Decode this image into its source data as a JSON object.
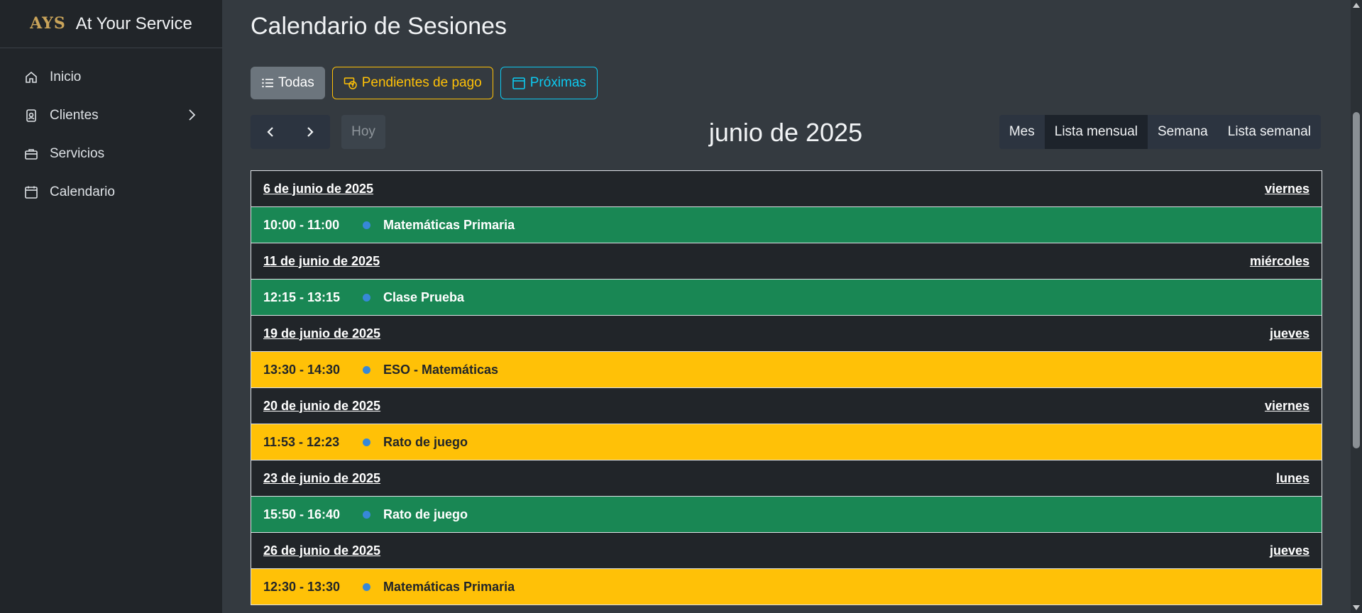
{
  "app": {
    "logo_text": "AYS",
    "name": "At Your Service"
  },
  "sidebar": {
    "items": [
      {
        "label": "Inicio",
        "icon": "home-icon"
      },
      {
        "label": "Clientes",
        "icon": "user-badge-icon",
        "has_submenu": true
      },
      {
        "label": "Servicios",
        "icon": "briefcase-icon"
      },
      {
        "label": "Calendario",
        "icon": "calendar-icon"
      }
    ]
  },
  "page": {
    "title": "Calendario de Sesiones"
  },
  "filters": {
    "todas": "Todas",
    "pendientes": "Pendientes de pago",
    "proximas": "Próximas"
  },
  "toolbar": {
    "today": "Hoy",
    "month_title": "junio de 2025",
    "views": [
      "Mes",
      "Lista mensual",
      "Semana",
      "Lista semanal"
    ],
    "active_view": "Lista mensual"
  },
  "colors": {
    "paid": "#198754",
    "pending": "#ffc107",
    "event_dot": "#3788d8"
  },
  "days": [
    {
      "date": "6 de junio de 2025",
      "weekday": "viernes",
      "events": [
        {
          "time": "10:00 - 11:00",
          "title": "Matemáticas Primaria",
          "status": "green"
        }
      ]
    },
    {
      "date": "11 de junio de 2025",
      "weekday": "miércoles",
      "events": [
        {
          "time": "12:15 - 13:15",
          "title": "Clase Prueba",
          "status": "green"
        }
      ]
    },
    {
      "date": "19 de junio de 2025",
      "weekday": "jueves",
      "events": [
        {
          "time": "13:30 - 14:30",
          "title": "ESO - Matemáticas",
          "status": "yellow"
        }
      ]
    },
    {
      "date": "20 de junio de 2025",
      "weekday": "viernes",
      "events": [
        {
          "time": "11:53 - 12:23",
          "title": "Rato de juego",
          "status": "yellow"
        }
      ]
    },
    {
      "date": "23 de junio de 2025",
      "weekday": "lunes",
      "events": [
        {
          "time": "15:50 - 16:40",
          "title": "Rato de juego",
          "status": "green"
        }
      ]
    },
    {
      "date": "26 de junio de 2025",
      "weekday": "jueves",
      "events": [
        {
          "time": "12:30 - 13:30",
          "title": "Matemáticas Primaria",
          "status": "yellow"
        }
      ]
    }
  ]
}
